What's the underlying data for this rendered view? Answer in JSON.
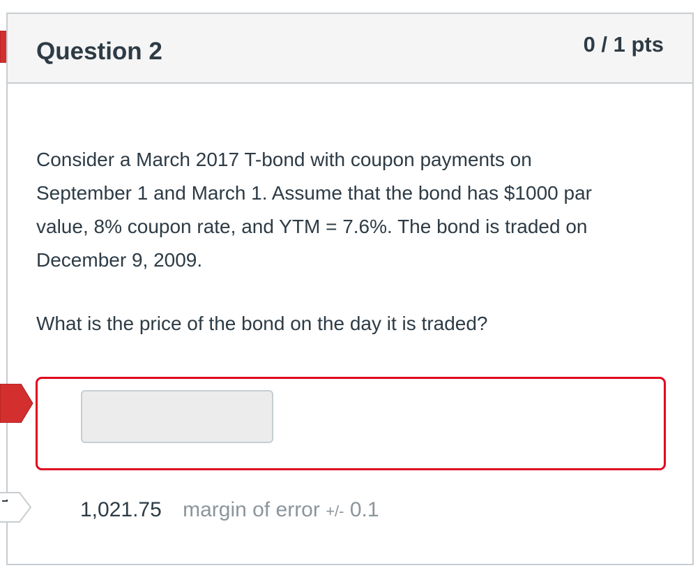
{
  "question": {
    "title": "Question 2",
    "points": "0 / 1 pts",
    "body": [
      "Consider a March 2017 T-bond with coupon payments on",
      "September 1 and March 1. Assume that the bond has $1000 par",
      "value, 8% coupon rate, and YTM = 7.6%. The bond is traded on",
      "December 9, 2009."
    ],
    "prompt": "What is the price of the bond on the day it is traded?"
  },
  "answer": {
    "input_value": "",
    "correct_value": "1,021.75",
    "margin_label": "margin of error",
    "margin_sign": "+/-",
    "margin_value": "0.1"
  },
  "flags": {
    "question_flag": "incorrect-flag-icon",
    "answer_flag": "incorrect-answer-flag-icon",
    "correct_flag": "correct-answer-flag-icon"
  },
  "colors": {
    "flag_red": "#d32f2f",
    "error_border": "#e0061f",
    "text": "#2d3b45",
    "muted": "#8b959b"
  }
}
